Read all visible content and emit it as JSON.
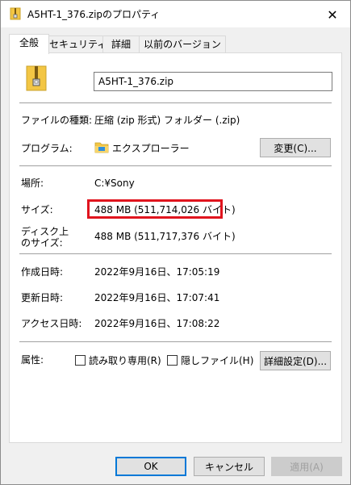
{
  "window": {
    "title": "A5HT-1_376.zipのプロパティ",
    "close_glyph": "✕"
  },
  "tabs": [
    {
      "label": "全般",
      "active": true
    },
    {
      "label": "セキュリティ",
      "active": false
    },
    {
      "label": "詳細",
      "active": false
    },
    {
      "label": "以前のバージョン",
      "active": false
    }
  ],
  "general": {
    "file_name": "A5HT-1_376.zip",
    "file_type_label": "ファイルの種類:",
    "file_type_value": "圧縮 (zip 形式) フォルダー (.zip)",
    "program_label": "プログラム:",
    "program_value": "エクスプローラー",
    "change_button": "変更(C)...",
    "location_label": "場所:",
    "location_value": "C:¥Sony",
    "size_label": "サイズ:",
    "size_value": "488 MB (511,714,026 バイト)",
    "size_on_disk_label_line1": "ディスク上",
    "size_on_disk_label_line2": "のサイズ:",
    "size_on_disk_value": "488 MB (511,717,376 バイト)",
    "created_label": "作成日時:",
    "created_value": "2022年9月16日、17:05:19",
    "modified_label": "更新日時:",
    "modified_value": "2022年9月16日、17:07:41",
    "accessed_label": "アクセス日時:",
    "accessed_value": "2022年9月16日、17:08:22",
    "attributes_label": "属性:",
    "readonly_label": "読み取り専用(R)",
    "readonly_checked": false,
    "hidden_label": "隠しファイル(H)",
    "hidden_checked": false,
    "advanced_button": "詳細設定(D)..."
  },
  "footer": {
    "ok_button": "OK",
    "cancel_button": "キャンセル",
    "apply_button": "適用(A)"
  },
  "colors": {
    "highlight_border": "#e0141e",
    "focus_blue": "#0078d7",
    "zip_yellow": "#f3c644"
  },
  "icons": {
    "title": "zip-folder-icon",
    "file": "zip-folder-large-icon",
    "program": "file-explorer-icon"
  }
}
